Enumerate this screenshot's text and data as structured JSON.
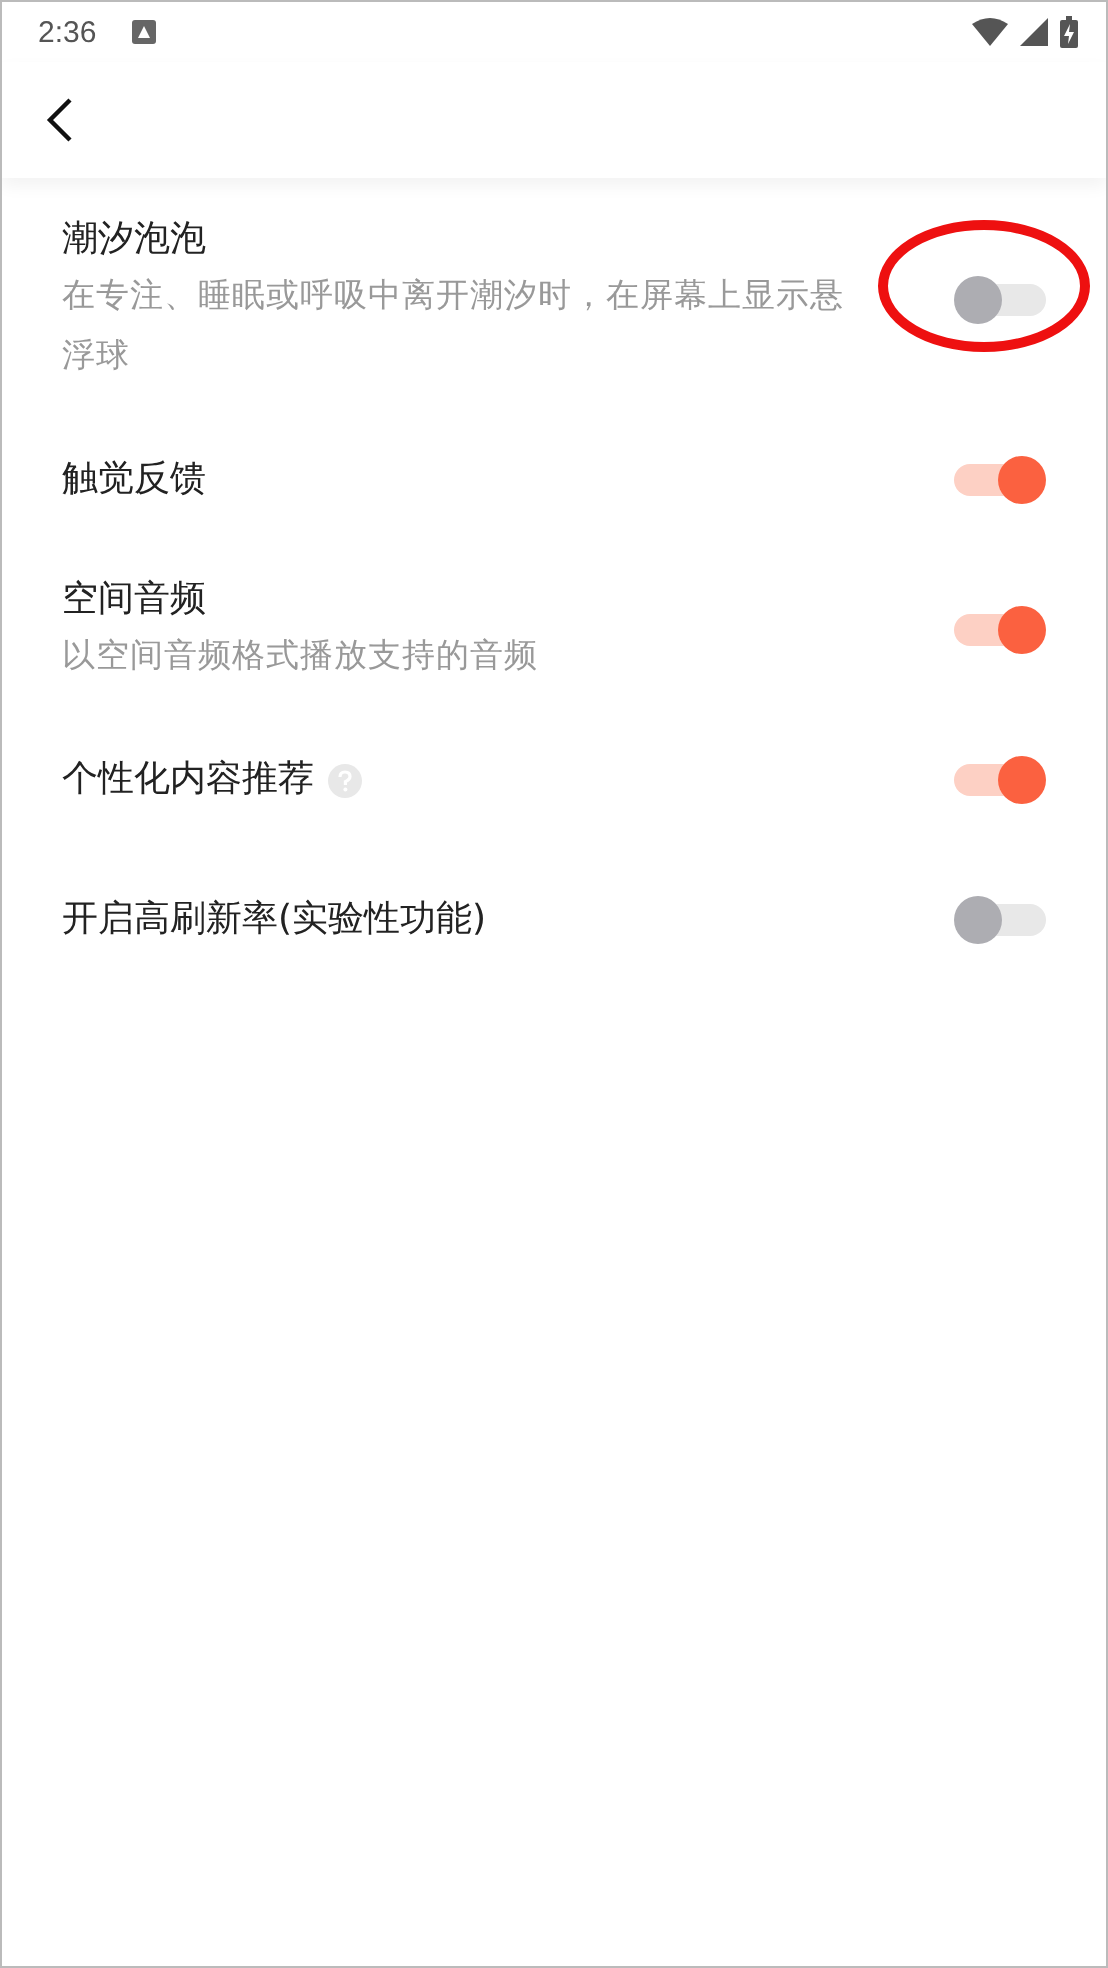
{
  "status_bar": {
    "time": "2:36"
  },
  "settings": [
    {
      "title": "潮汐泡泡",
      "description": "在专注、睡眠或呼吸中离开潮汐时，在屏幕上显示悬浮球",
      "on": false,
      "help": false,
      "circled": true
    },
    {
      "title": "触觉反馈",
      "on": true,
      "help": false,
      "circled": false
    },
    {
      "title": "空间音频",
      "description": "以空间音频格式播放支持的音频",
      "on": true,
      "help": false,
      "circled": false
    },
    {
      "title": "个性化内容推荐",
      "on": true,
      "help": true,
      "circled": false
    },
    {
      "title": "开启高刷新率(实验性功能)",
      "on": false,
      "help": false,
      "circled": false
    }
  ]
}
